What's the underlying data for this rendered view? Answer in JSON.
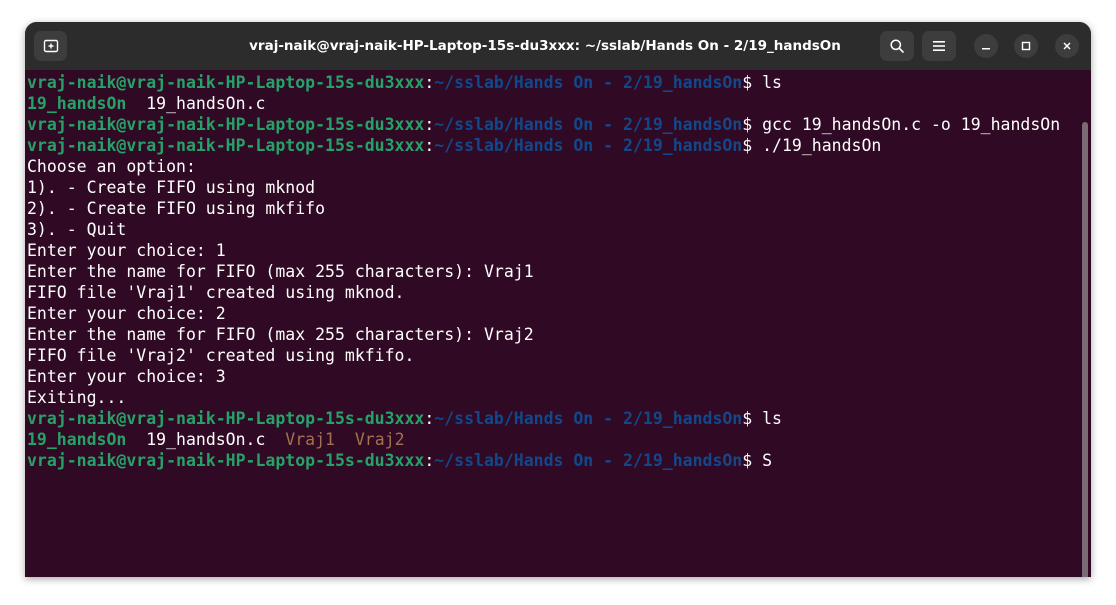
{
  "window": {
    "title": "vraj-naik@vraj-naik-HP-Laptop-15s-du3xxx: ~/sslab/Hands On - 2/19_handsOn",
    "icons": {
      "new_tab": "new-tab-icon",
      "search": "search-icon",
      "menu": "hamburger-menu-icon",
      "minimize": "minimize-icon",
      "maximize": "maximize-icon",
      "close": "close-icon"
    }
  },
  "colors": {
    "terminal_bg": "#300a24",
    "user": "#26a269",
    "path": "#12488b",
    "fifo": "#a2734c",
    "text": "#ffffff"
  },
  "terminal": {
    "lines": [
      [
        {
          "t": "vraj-naik@vraj-naik-HP-Laptop-15s-du3xxx",
          "k": "u"
        },
        {
          "t": ":",
          "k": "o"
        },
        {
          "t": "~/sslab/Hands On - 2/19_handsOn",
          "k": "p"
        },
        {
          "t": "$ ls",
          "k": "c"
        }
      ],
      [
        {
          "t": "19_handsOn",
          "k": "d"
        },
        {
          "t": "  19_handsOn.c",
          "k": "o"
        }
      ],
      [
        {
          "t": "vraj-naik@vraj-naik-HP-Laptop-15s-du3xxx",
          "k": "u"
        },
        {
          "t": ":",
          "k": "o"
        },
        {
          "t": "~/sslab/Hands On - 2/19_handsOn",
          "k": "p"
        },
        {
          "t": "$ gcc 19_handsOn.c -o 19_handsOn",
          "k": "c"
        }
      ],
      [
        {
          "t": "vraj-naik@vraj-naik-HP-Laptop-15s-du3xxx",
          "k": "u"
        },
        {
          "t": ":",
          "k": "o"
        },
        {
          "t": "~/sslab/Hands On - 2/19_handsOn",
          "k": "p"
        },
        {
          "t": "$ ./19_handsOn",
          "k": "c"
        }
      ],
      [
        {
          "t": "Choose an option:",
          "k": "o"
        }
      ],
      [
        {
          "t": "1). - Create FIFO using mknod",
          "k": "o"
        }
      ],
      [
        {
          "t": "2). - Create FIFO using mkfifo",
          "k": "o"
        }
      ],
      [
        {
          "t": "3). - Quit",
          "k": "o"
        }
      ],
      [
        {
          "t": "Enter your choice: 1",
          "k": "o"
        }
      ],
      [
        {
          "t": "Enter the name for FIFO (max 255 characters): Vraj1",
          "k": "o"
        }
      ],
      [
        {
          "t": "FIFO file 'Vraj1' created using mknod.",
          "k": "o"
        }
      ],
      [
        {
          "t": "Enter your choice: 2",
          "k": "o"
        }
      ],
      [
        {
          "t": "Enter the name for FIFO (max 255 characters): Vraj2",
          "k": "o"
        }
      ],
      [
        {
          "t": "FIFO file 'Vraj2' created using mkfifo.",
          "k": "o"
        }
      ],
      [
        {
          "t": "Enter your choice: 3",
          "k": "o"
        }
      ],
      [
        {
          "t": "Exiting...",
          "k": "o"
        }
      ],
      [
        {
          "t": "vraj-naik@vraj-naik-HP-Laptop-15s-du3xxx",
          "k": "u"
        },
        {
          "t": ":",
          "k": "o"
        },
        {
          "t": "~/sslab/Hands On - 2/19_handsOn",
          "k": "p"
        },
        {
          "t": "$ ls",
          "k": "c"
        }
      ],
      [
        {
          "t": "19_handsOn",
          "k": "d"
        },
        {
          "t": "  19_handsOn.c  ",
          "k": "o"
        },
        {
          "t": "Vraj1",
          "k": "f"
        },
        {
          "t": "  ",
          "k": "o"
        },
        {
          "t": "Vraj2",
          "k": "f"
        }
      ],
      [
        {
          "t": "vraj-naik@vraj-naik-HP-Laptop-15s-du3xxx",
          "k": "u"
        },
        {
          "t": ":",
          "k": "o"
        },
        {
          "t": "~/sslab/Hands On - 2/19_handsOn",
          "k": "p"
        },
        {
          "t": "$ S",
          "k": "c"
        }
      ]
    ]
  }
}
